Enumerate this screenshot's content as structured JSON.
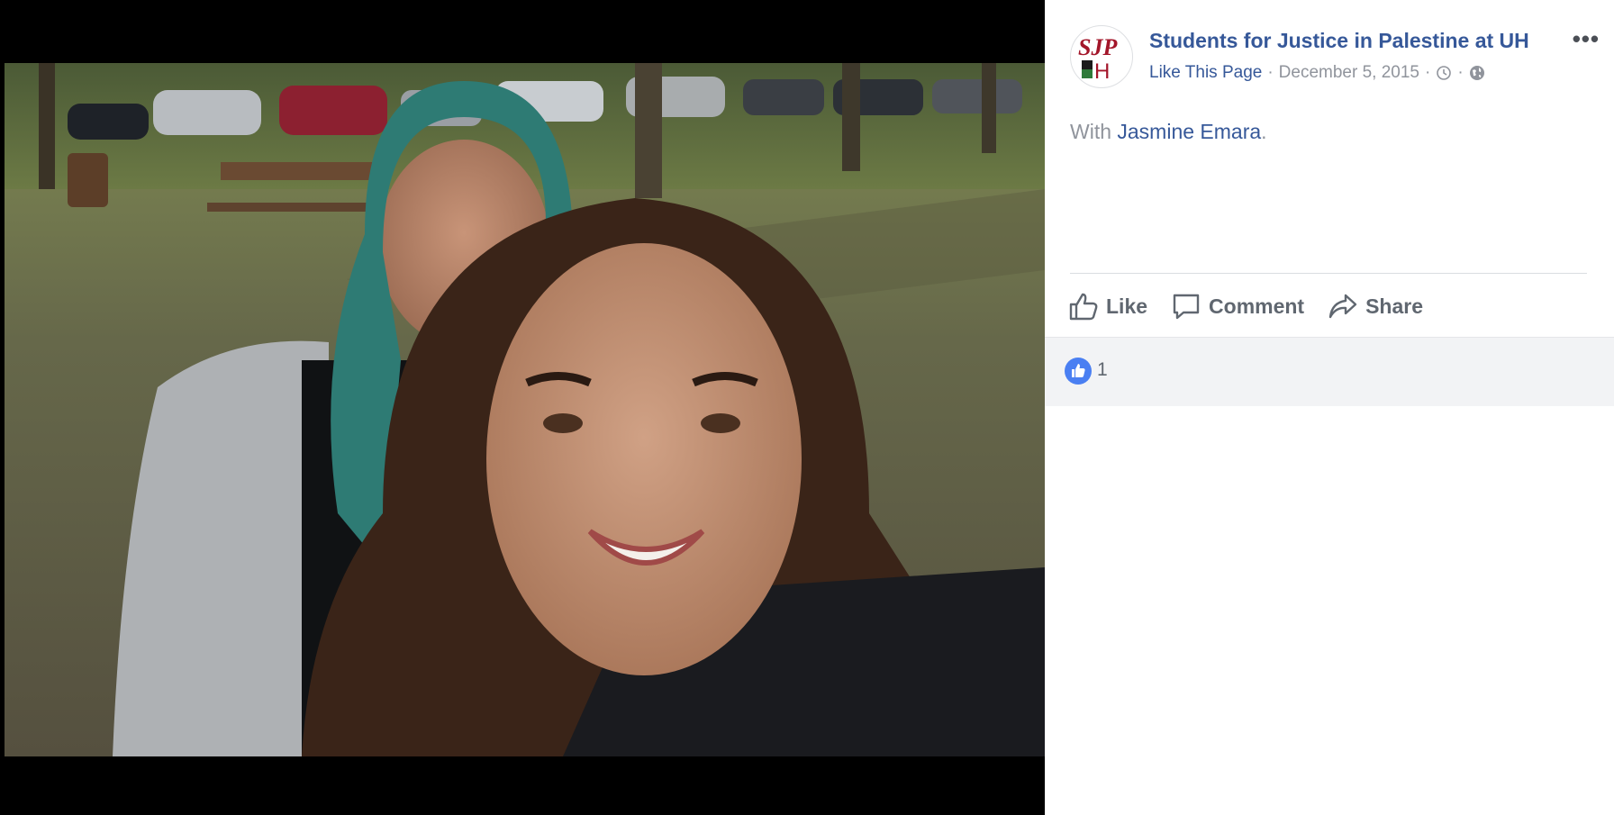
{
  "post": {
    "page_name": "Students for Justice in Palestine at UH",
    "avatar_text": "SJP UH",
    "more_label": "•••",
    "like_page": "Like This Page",
    "separator": "·",
    "date": "December 5, 2015",
    "caption_prefix": "With",
    "tagged_person": "Jasmine Emara",
    "caption_suffix": ".",
    "icons": {
      "more": "more-options-icon",
      "time": "clock-icon",
      "audience": "globe-icon"
    }
  },
  "actions": [
    {
      "label": "Like",
      "icon": "thumbs-up-icon"
    },
    {
      "label": "Comment",
      "icon": "comment-icon"
    },
    {
      "label": "Share",
      "icon": "share-icon"
    }
  ],
  "reactions": {
    "count": "1",
    "icon": "like-reaction-icon"
  },
  "colors": {
    "link": "#365899",
    "meta": "#90949c",
    "action": "#606770",
    "like_blue": "#4a7ff2",
    "viewer_background": "#000000"
  }
}
